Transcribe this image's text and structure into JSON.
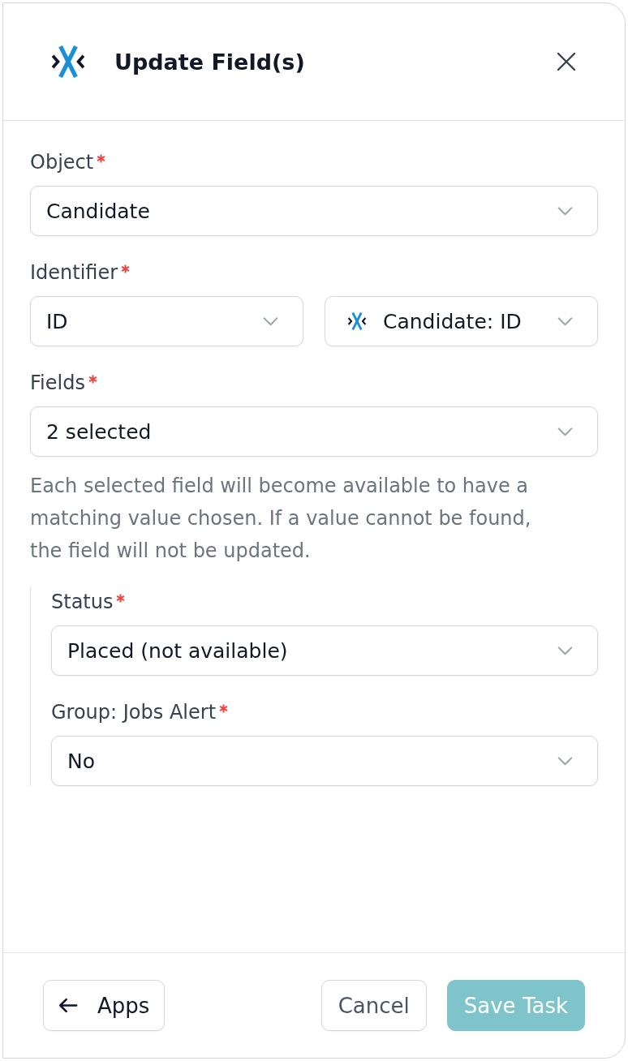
{
  "header": {
    "title": "Update Field(s)"
  },
  "form": {
    "fields": [
      {
        "kind": "select",
        "label": "Object",
        "required": true,
        "selects": [
          {
            "value": "Candidate",
            "logo": false
          }
        ]
      },
      {
        "kind": "select",
        "label": "Identifier",
        "required": true,
        "selects": [
          {
            "value": "ID",
            "logo": false
          },
          {
            "value": "Candidate: ID",
            "logo": true
          }
        ]
      },
      {
        "kind": "select",
        "label": "Fields",
        "required": true,
        "selects": [
          {
            "value": "2 selected",
            "logo": false
          }
        ],
        "help": "Each selected field will become available to have a matching value chosen. If a value cannot be found, the field will not be updated."
      }
    ],
    "mapped_fields": [
      {
        "label": "Status",
        "required": true,
        "value": "Placed (not available)"
      },
      {
        "label": "Group: Jobs Alert",
        "required": true,
        "value": "No"
      }
    ]
  },
  "footer": {
    "back_button": {
      "label": "Apps"
    },
    "buttons": [
      {
        "label": "Cancel",
        "kind": "secondary",
        "disabled": false
      },
      {
        "label": "Save Task",
        "kind": "primary",
        "disabled": true
      }
    ]
  }
}
